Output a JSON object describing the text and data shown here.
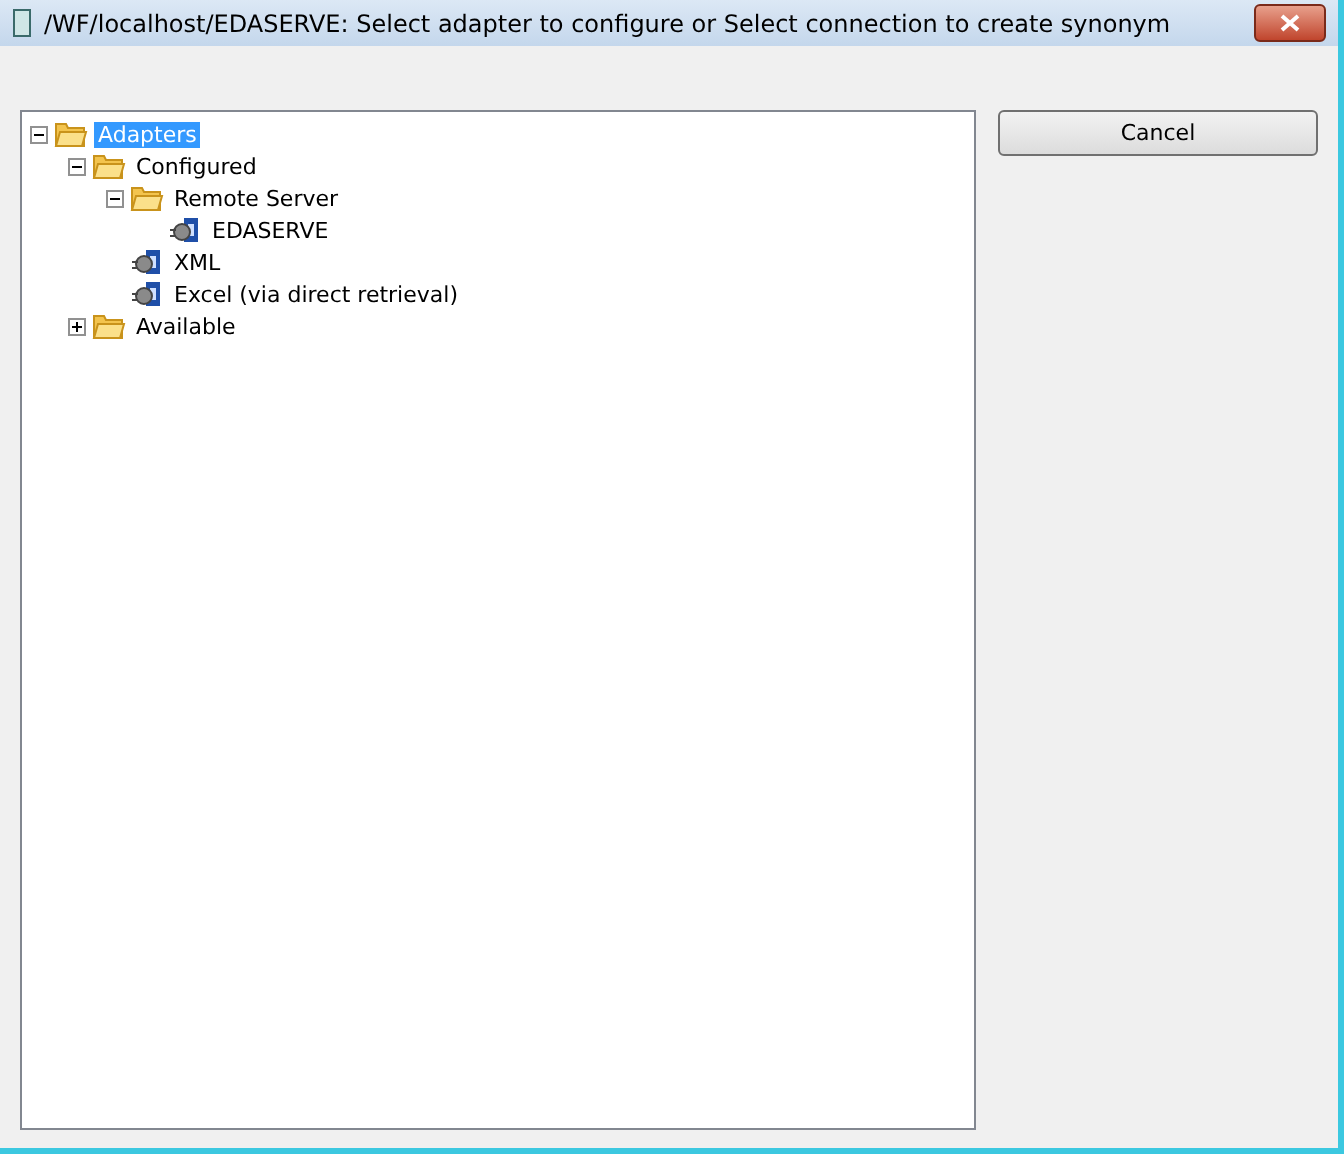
{
  "window": {
    "title": "/WF/localhost/EDASERVE: Select adapter to configure or Select connection to create synonym"
  },
  "tree": [
    {
      "label": "Adapters",
      "kind": "folder",
      "expanded": true,
      "selected": true,
      "children": [
        {
          "label": "Configured",
          "kind": "folder",
          "expanded": true,
          "selected": false,
          "children": [
            {
              "label": "Remote Server",
              "kind": "folder",
              "expanded": true,
              "selected": false,
              "children": [
                {
                  "label": "EDASERVE",
                  "kind": "adapter",
                  "selected": false
                }
              ]
            },
            {
              "label": "XML",
              "kind": "adapter",
              "selected": false
            },
            {
              "label": "Excel (via direct retrieval)",
              "kind": "adapter",
              "selected": false
            }
          ]
        },
        {
          "label": "Available",
          "kind": "folder",
          "expanded": false,
          "selected": false
        }
      ]
    }
  ],
  "buttons": [
    {
      "label": "Cancel"
    }
  ]
}
